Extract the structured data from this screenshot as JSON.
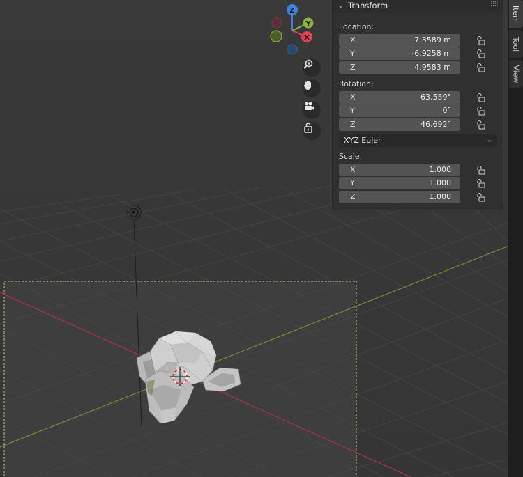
{
  "gizmo": {
    "x_label": "X",
    "y_label": "Y",
    "z_label": "Z"
  },
  "nav_tools": [
    "zoom-icon",
    "hand-pan-icon",
    "camera-icon",
    "lock-icon"
  ],
  "panel": {
    "title": "Transform",
    "location": {
      "label": "Location:",
      "rows": [
        {
          "axis": "X",
          "value": "7.3589 m"
        },
        {
          "axis": "Y",
          "value": "-6.9258 m"
        },
        {
          "axis": "Z",
          "value": "4.9583 m"
        }
      ]
    },
    "rotation": {
      "label": "Rotation:",
      "rows": [
        {
          "axis": "X",
          "value": "63.559°"
        },
        {
          "axis": "Y",
          "value": "0°"
        },
        {
          "axis": "Z",
          "value": "46.692°"
        }
      ]
    },
    "rotation_mode": "XYZ Euler",
    "scale": {
      "label": "Scale:",
      "rows": [
        {
          "axis": "X",
          "value": "1.000"
        },
        {
          "axis": "Y",
          "value": "1.000"
        },
        {
          "axis": "Z",
          "value": "1.000"
        }
      ]
    }
  },
  "tabs": [
    "Item",
    "Tool",
    "View"
  ],
  "colors": {
    "x_axis": "#e53f55",
    "y_axis": "#8cb43c",
    "z_axis": "#3d83e6",
    "viewport_bg": "#393939",
    "panel_bg": "#303030",
    "field_bg": "#545454"
  }
}
